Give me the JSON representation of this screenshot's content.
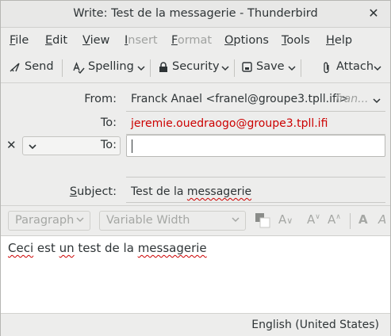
{
  "window": {
    "title": "Write: Test de la messagerie - Thunderbird"
  },
  "menu": {
    "file": "File",
    "edit": "Edit",
    "view": "View",
    "insert": "Insert",
    "format": "Format",
    "options": "Options",
    "tools": "Tools",
    "help": "Help"
  },
  "toolbar": {
    "send": "Send",
    "spelling": "Spelling",
    "security": "Security",
    "save": "Save",
    "attach": "Attach"
  },
  "headers": {
    "from_label": "From:",
    "from_value": "Franck Anael <franel@groupe3.tpll.ifi>",
    "from_hint": "fran...",
    "to_label": "To:",
    "to_value": "jeremie.ouedraogo@groupe3.tpll.ifi",
    "to2_label": "To:",
    "subject_label": "Subject:",
    "subject_value": "Test de la messagerie"
  },
  "format": {
    "paragraph": "Paragraph",
    "font": "Variable Width"
  },
  "body": {
    "text": "Ceci est un test de la messagerie"
  },
  "status": {
    "language": "English (United States)"
  },
  "colors": {
    "recipient": "#cc0000",
    "spell_underline": "#cc0000"
  }
}
